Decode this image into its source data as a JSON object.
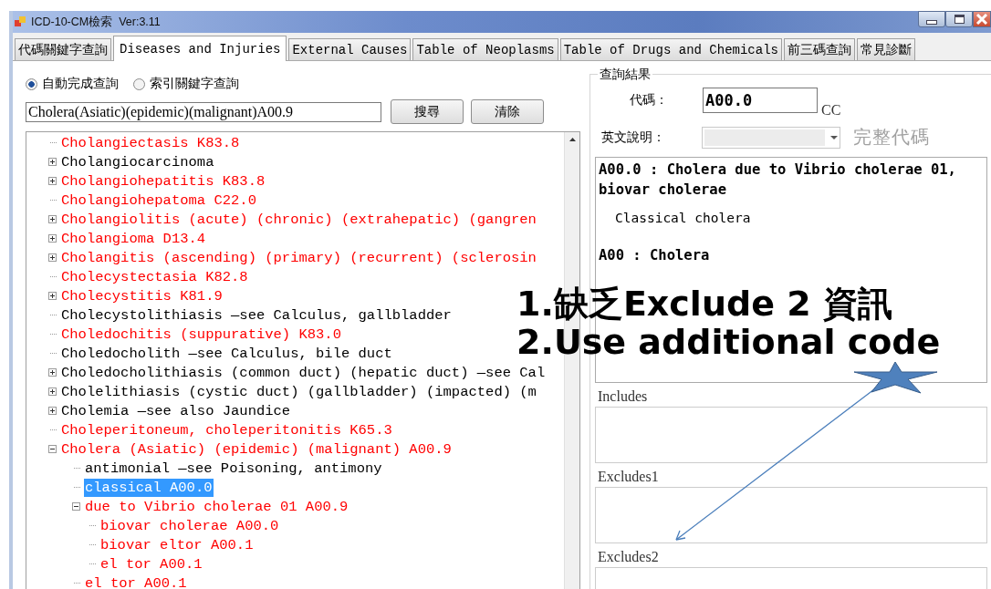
{
  "window": {
    "title": "ICD-10-CM檢索  Ver:3.11"
  },
  "tabs": [
    {
      "label": "代碼關鍵字查詢",
      "selected": false
    },
    {
      "label": "Diseases and Injuries",
      "selected": true
    },
    {
      "label": "External Causes",
      "selected": false
    },
    {
      "label": "Table of Neoplasms",
      "selected": false
    },
    {
      "label": "Table of Drugs and Chemicals",
      "selected": false
    },
    {
      "label": "前三碼查詢",
      "selected": false
    },
    {
      "label": "常見診斷",
      "selected": false
    }
  ],
  "search_modes": [
    {
      "label": "自動完成查詢",
      "selected": true
    },
    {
      "label": "索引關鍵字查詢",
      "selected": false
    }
  ],
  "search": {
    "value": "Cholera(Asiatic)(epidemic)(malignant)A00.9",
    "buttons": [
      "搜尋",
      "清除"
    ]
  },
  "tree": {
    "items": [
      {
        "label": "Cholangiectasis K83.8",
        "color": "#ff0000",
        "kind": "leaf",
        "selected": false
      },
      {
        "label": "Cholangiocarcinoma",
        "color": "#000000",
        "kind": "branch",
        "expanded": false,
        "selected": false
      },
      {
        "label": "Cholangiohepatitis K83.8",
        "color": "#ff0000",
        "kind": "branch",
        "expanded": false,
        "selected": false
      },
      {
        "label": "Cholangiohepatoma C22.0",
        "color": "#ff0000",
        "kind": "leaf",
        "selected": false
      },
      {
        "label": "Cholangiolitis (acute) (chronic) (extrahepatic) (gangren",
        "color": "#ff0000",
        "kind": "branch",
        "expanded": false,
        "selected": false
      },
      {
        "label": "Cholangioma D13.4",
        "color": "#ff0000",
        "kind": "branch",
        "expanded": false,
        "selected": false
      },
      {
        "label": "Cholangitis (ascending) (primary) (recurrent) (sclerosin",
        "color": "#ff0000",
        "kind": "branch",
        "expanded": false,
        "selected": false
      },
      {
        "label": "Cholecystectasia K82.8",
        "color": "#ff0000",
        "kind": "leaf",
        "selected": false
      },
      {
        "label": "Cholecystitis K81.9",
        "color": "#ff0000",
        "kind": "branch",
        "expanded": false,
        "selected": false
      },
      {
        "label": "Cholecystolithiasis —see Calculus, gallbladder",
        "color": "#000000",
        "kind": "leaf",
        "selected": false
      },
      {
        "label": "Choledochitis (suppurative) K83.0",
        "color": "#ff0000",
        "kind": "leaf",
        "selected": false
      },
      {
        "label": "Choledocholith —see Calculus, bile duct",
        "color": "#000000",
        "kind": "leaf",
        "selected": false
      },
      {
        "label": "Choledocholithiasis (common duct) (hepatic duct) —see Cal",
        "color": "#000000",
        "kind": "branch",
        "expanded": false,
        "selected": false
      },
      {
        "label": "Cholelithiasis (cystic duct) (gallbladder) (impacted) (m",
        "color": "#000000",
        "kind": "branch",
        "expanded": false,
        "selected": false
      },
      {
        "label": "Cholemia —see also Jaundice",
        "color": "#000000",
        "kind": "branch",
        "expanded": false,
        "selected": false
      },
      {
        "label": "Choleperitoneum, choleperitonitis K65.3",
        "color": "#ff0000",
        "kind": "leaf",
        "selected": false
      },
      {
        "label": "Cholera (Asiatic) (epidemic) (malignant) A00.9",
        "color": "#ff0000",
        "kind": "branch",
        "expanded": true,
        "selected": false,
        "children": [
          {
            "label": "antimonial —see Poisoning, antimony",
            "color": "#000000",
            "kind": "leaf",
            "selected": false
          },
          {
            "label": "classical A00.0",
            "kind": "leaf",
            "selected": true
          },
          {
            "label": "due to Vibrio cholerae 01 A00.9",
            "color": "#ff0000",
            "kind": "branch",
            "expanded": true,
            "selected": false,
            "children": [
              {
                "label": "biovar cholerae A00.0",
                "color": "#ff0000",
                "kind": "leaf",
                "selected": false
              },
              {
                "label": "biovar eltor A00.1",
                "color": "#ff0000",
                "kind": "leaf",
                "selected": false
              },
              {
                "label": "el tor A00.1",
                "color": "#ff0000",
                "kind": "leaf",
                "selected": false
              }
            ]
          },
          {
            "label": "el tor A00.1",
            "color": "#ff0000",
            "kind": "leaf",
            "selected": false
          }
        ]
      }
    ]
  },
  "result": {
    "title": "查詢結果",
    "code_label": "代碼：",
    "code": "A00.0",
    "cc": "CC",
    "english_label": "英文說明：",
    "full_code": "完整代碼",
    "description": [
      {
        "kind": "heading",
        "text": "A00.0 : Cholera due to Vibrio cholerae 01, biovar cholerae"
      },
      {
        "kind": "note",
        "text": "Classical cholera"
      },
      {
        "kind": "heading",
        "text": "A00 : Cholera"
      }
    ],
    "sections": [
      "Includes",
      "Excludes1",
      "Excludes2"
    ]
  },
  "annotation": {
    "lines": [
      "1.缺乏Exclude 2 資訊",
      "2.Use additional code"
    ]
  }
}
